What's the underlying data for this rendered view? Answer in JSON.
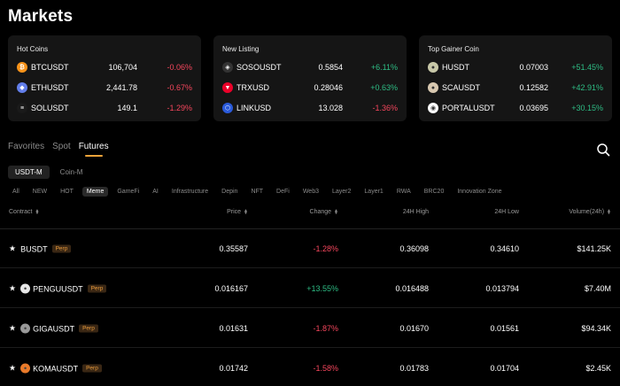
{
  "page_title": "Markets",
  "cards": [
    {
      "title": "Hot Coins",
      "rows": [
        {
          "symbol": "BTCUSDT",
          "price": "106,704",
          "change": "-0.06%",
          "dir": "neg",
          "icon": "bitcoin-icon",
          "glyph": "₿",
          "color": "#f7931a"
        },
        {
          "symbol": "ETHUSDT",
          "price": "2,441.78",
          "change": "-0.67%",
          "dir": "neg",
          "icon": "ethereum-icon",
          "glyph": "◆",
          "color": "#627eea"
        },
        {
          "symbol": "SOLUSDT",
          "price": "149.1",
          "change": "-1.29%",
          "dir": "neg",
          "icon": "solana-icon",
          "glyph": "≡",
          "color": "#1a1a1a"
        }
      ]
    },
    {
      "title": "New Listing",
      "rows": [
        {
          "symbol": "SOSOUSDT",
          "price": "0.5854",
          "change": "+6.11%",
          "dir": "pos",
          "icon": "soso-icon",
          "glyph": "◈",
          "color": "#333333"
        },
        {
          "symbol": "TRXUSD",
          "price": "0.28046",
          "change": "+0.63%",
          "dir": "pos",
          "icon": "tron-icon",
          "glyph": "▼",
          "color": "#eb0029"
        },
        {
          "symbol": "LINKUSD",
          "price": "13.028",
          "change": "-1.36%",
          "dir": "neg",
          "icon": "chainlink-icon",
          "glyph": "⬡",
          "color": "#2a5ada"
        }
      ]
    },
    {
      "title": "Top Gainer Coin",
      "rows": [
        {
          "symbol": "HUSDT",
          "price": "0.07003",
          "change": "+51.45%",
          "dir": "pos",
          "icon": "h-coin-icon",
          "glyph": "●",
          "color": "#c8c8a8"
        },
        {
          "symbol": "SCAUSDT",
          "price": "0.12582",
          "change": "+42.91%",
          "dir": "pos",
          "icon": "sca-coin-icon",
          "glyph": "●",
          "color": "#d8c8b0"
        },
        {
          "symbol": "PORTALUSDT",
          "price": "0.03695",
          "change": "+30.15%",
          "dir": "pos",
          "icon": "portal-coin-icon",
          "glyph": "◉",
          "color": "#ffffff"
        }
      ]
    }
  ],
  "tabs": [
    "Favorites",
    "Spot",
    "Futures"
  ],
  "active_tab": "Futures",
  "segments": [
    "USDT-M",
    "Coin-M"
  ],
  "active_segment": "USDT-M",
  "categories": [
    "All",
    "NEW",
    "HOT",
    "Meme",
    "GameFi",
    "AI",
    "Infrastructure",
    "Depin",
    "NFT",
    "DeFi",
    "Web3",
    "Layer2",
    "Layer1",
    "RWA",
    "BRC20",
    "Innovation Zone"
  ],
  "active_category": "Meme",
  "table": {
    "headers": {
      "contract": "Contract",
      "price": "Price",
      "change": "Change",
      "high": "24H High",
      "low": "24H Low",
      "volume": "Volume(24h)"
    },
    "rows": [
      {
        "symbol": "BUSDT",
        "badge": "Perp",
        "price": "0.35587",
        "change": "-1.28%",
        "dir": "neg",
        "high": "0.36098",
        "low": "0.34610",
        "volume": "$141.25K",
        "coin_icon": "",
        "coin_color": ""
      },
      {
        "symbol": "PENGUUSDT",
        "badge": "Perp",
        "price": "0.016167",
        "change": "+13.55%",
        "dir": "pos",
        "high": "0.016488",
        "low": "0.013794",
        "volume": "$7.40M",
        "coin_icon": "pengu-coin-icon",
        "coin_color": "#e8e8e8"
      },
      {
        "symbol": "GIGAUSDT",
        "badge": "Perp",
        "price": "0.01631",
        "change": "-1.87%",
        "dir": "neg",
        "high": "0.01670",
        "low": "0.01561",
        "volume": "$94.34K",
        "coin_icon": "giga-coin-icon",
        "coin_color": "#9a9a9a"
      },
      {
        "symbol": "KOMAUSDT",
        "badge": "Perp",
        "price": "0.01742",
        "change": "-1.58%",
        "dir": "neg",
        "high": "0.01783",
        "low": "0.01704",
        "volume": "$2.45K",
        "coin_icon": "koma-coin-icon",
        "coin_color": "#e87a2a"
      }
    ]
  }
}
